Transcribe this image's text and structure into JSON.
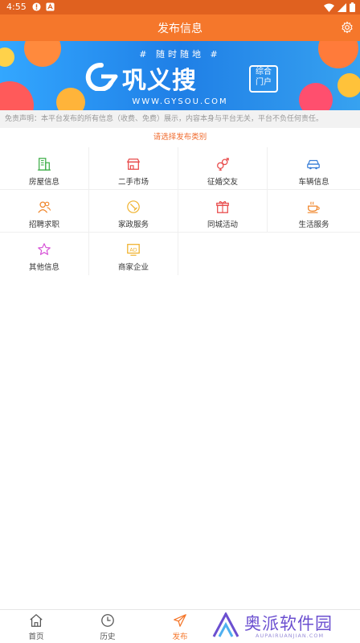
{
  "status_bar": {
    "time": "4:55"
  },
  "app_bar": {
    "title": "发布信息"
  },
  "banner": {
    "tagline": "# 随时随地 #",
    "brand": "巩义搜",
    "badge_line1": "综合",
    "badge_line2": "门户",
    "url": "WWW.GYSOU.COM"
  },
  "disclaimer": "免责声明：本平台发布的所有信息（收费、免费）展示，内容本身与平台无关，平台不负任何责任。",
  "prompt": "请选择发布类别",
  "categories": [
    {
      "label": "房屋信息",
      "icon": "building-icon",
      "color": "#3fae49"
    },
    {
      "label": "二手市场",
      "icon": "shop-icon",
      "color": "#e84a4a"
    },
    {
      "label": "征婚交友",
      "icon": "gender-icon",
      "color": "#e84a4a"
    },
    {
      "label": "车辆信息",
      "icon": "car-icon",
      "color": "#3a7fd8"
    },
    {
      "label": "招聘求职",
      "icon": "people-icon",
      "color": "#f0862b"
    },
    {
      "label": "家政服务",
      "icon": "broom-icon",
      "color": "#f0b12b"
    },
    {
      "label": "同城活动",
      "icon": "gift-icon",
      "color": "#e84a4a"
    },
    {
      "label": "生活服务",
      "icon": "cup-icon",
      "color": "#f0862b"
    },
    {
      "label": "其他信息",
      "icon": "star-icon",
      "color": "#d64fd6"
    },
    {
      "label": "商家企业",
      "icon": "ad-icon",
      "color": "#f0b12b"
    }
  ],
  "bottom_nav": {
    "items": [
      {
        "label": "首页",
        "icon": "home-icon",
        "active": false
      },
      {
        "label": "历史",
        "icon": "clock-icon",
        "active": false
      },
      {
        "label": "发布",
        "icon": "send-icon",
        "active": true
      }
    ],
    "active_color": "#f5772b",
    "inactive_color": "#555555"
  },
  "watermark": {
    "text": "奥派软件园",
    "sub": "AUPAIRUANJIAN.COM"
  },
  "colors": {
    "primary": "#f5772b",
    "statusbar": "#e0611f",
    "accent_text": "#f06a2c"
  }
}
